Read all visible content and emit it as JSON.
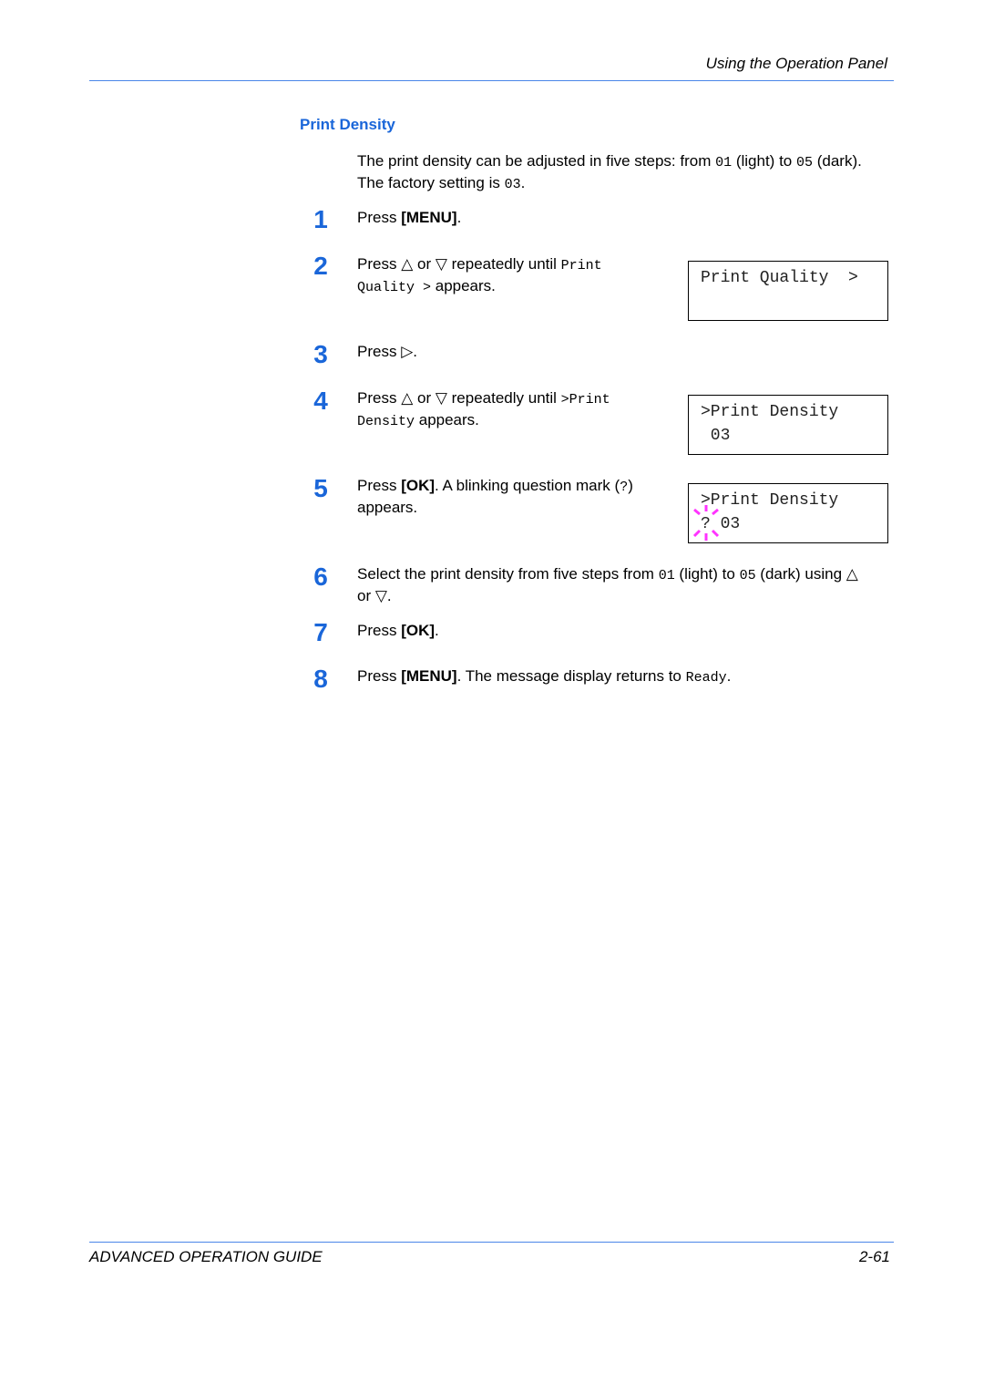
{
  "header": {
    "title": "Using the Operation Panel"
  },
  "section": {
    "title": "Print Density",
    "intro_line1_a": "The print density can be adjusted in five steps: from ",
    "intro_line1_code1": "01",
    "intro_line1_b": " (light) to ",
    "intro_line1_code2": "05",
    "intro_line1_c": " (dark).",
    "intro_line2_a": "The factory setting is ",
    "intro_line2_code": "03",
    "intro_line2_b": "."
  },
  "symbols": {
    "up": "△",
    "down": "▽",
    "right": "▷"
  },
  "steps": [
    {
      "num": "1",
      "a": "Press ",
      "key": "[MENU]",
      "b": "."
    },
    {
      "num": "2",
      "a": "Press ",
      "or": " or ",
      "c": " repeatedly until ",
      "code1": "Print",
      "code2": "Quality >",
      "d": " appears."
    },
    {
      "num": "3",
      "a": "Press ",
      "b": "."
    },
    {
      "num": "4",
      "a": "Press ",
      "or": " or ",
      "c": " repeatedly until ",
      "code1": ">Print",
      "code2": "Density",
      "d": " appears."
    },
    {
      "num": "5",
      "a": "Press ",
      "key": "[OK]",
      "b": ". A blinking question mark (",
      "code": "?",
      "c": ")",
      "d": "appears."
    },
    {
      "num": "6",
      "a": "Select the print density from five steps from ",
      "code1": "01",
      "b": " (light) to ",
      "code2": "05",
      "c": " (dark) using ",
      "d": "or ",
      "e": "."
    },
    {
      "num": "7",
      "a": "Press ",
      "key": "[OK]",
      "b": "."
    },
    {
      "num": "8",
      "a": "Press ",
      "key": "[MENU]",
      "b": ". The message display returns to ",
      "code": "Ready",
      "c": "."
    }
  ],
  "displays": [
    {
      "line1": "Print Quality  >",
      "line2": ""
    },
    {
      "line1": ">Print Density",
      "line2": " 03"
    },
    {
      "line1": ">Print Density",
      "line2": "? 03",
      "blink_color": "#ff33ff"
    }
  ],
  "footer": {
    "guide": "ADVANCED OPERATION GUIDE",
    "page": "2-61"
  }
}
